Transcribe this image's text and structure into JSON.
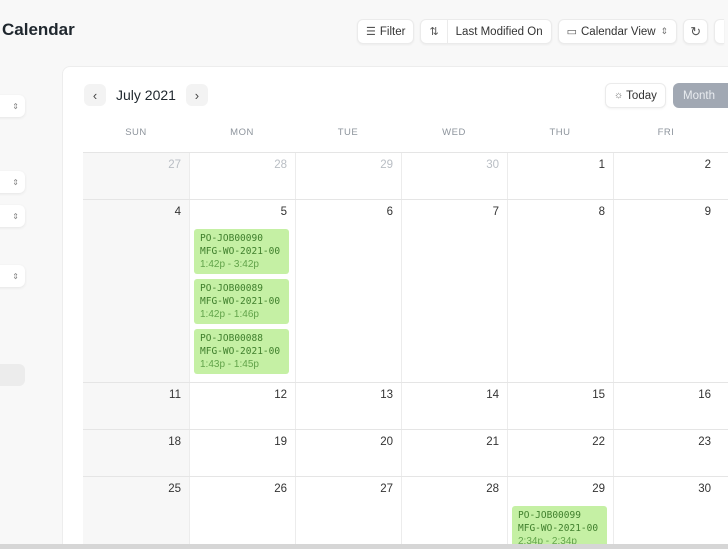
{
  "page": {
    "title": "Calendar"
  },
  "toolbar": {
    "filter_label": "Filter",
    "sort_label": "Last Modified On",
    "view_label": "Calendar View",
    "icons": {
      "filter": "filter-icon",
      "sort": "sort-icon",
      "calendar": "calendar-icon",
      "refresh": "refresh-icon"
    }
  },
  "sidebar": {
    "selects": [
      {
        "glyph": "⌃⌄"
      },
      {
        "glyph": "⌃⌄"
      },
      {
        "glyph": "⌃⌄"
      },
      {
        "glyph": "⌃⌄"
      }
    ]
  },
  "calendar": {
    "month_label": "July 2021",
    "prev_glyph": "‹",
    "next_glyph": "›",
    "today_label": "Today",
    "view_mode": "Month",
    "weekdays": [
      "SUN",
      "MON",
      "TUE",
      "WED",
      "THU",
      "FRI"
    ],
    "weeks": [
      {
        "days": [
          {
            "num": "27",
            "other": true
          },
          {
            "num": "28",
            "other": true
          },
          {
            "num": "29",
            "other": true
          },
          {
            "num": "30",
            "other": true
          },
          {
            "num": "1"
          },
          {
            "num": "2"
          }
        ]
      },
      {
        "days": [
          {
            "num": "4"
          },
          {
            "num": "5",
            "events": [
              {
                "title": "PO-JOB00090",
                "subtitle": "MFG-WO-2021-00",
                "time": "1:42p - 3:42p"
              },
              {
                "title": "PO-JOB00089",
                "subtitle": "MFG-WO-2021-00",
                "time": "1:42p - 1:46p"
              },
              {
                "title": "PO-JOB00088",
                "subtitle": "MFG-WO-2021-00",
                "time": "1:43p - 1:45p"
              }
            ]
          },
          {
            "num": "6"
          },
          {
            "num": "7"
          },
          {
            "num": "8"
          },
          {
            "num": "9"
          }
        ]
      },
      {
        "days": [
          {
            "num": "11"
          },
          {
            "num": "12"
          },
          {
            "num": "13"
          },
          {
            "num": "14"
          },
          {
            "num": "15"
          },
          {
            "num": "16"
          }
        ]
      },
      {
        "days": [
          {
            "num": "18"
          },
          {
            "num": "19"
          },
          {
            "num": "20"
          },
          {
            "num": "21"
          },
          {
            "num": "22"
          },
          {
            "num": "23"
          }
        ]
      },
      {
        "days": [
          {
            "num": "25"
          },
          {
            "num": "26"
          },
          {
            "num": "27"
          },
          {
            "num": "28"
          },
          {
            "num": "29",
            "events": [
              {
                "title": "PO-JOB00099",
                "subtitle": "MFG-WO-2021-00",
                "time": "2:34p - 2:34p"
              }
            ]
          },
          {
            "num": "30"
          }
        ]
      }
    ]
  },
  "colors": {
    "event_bg": "#c5f0a4",
    "event_text": "#3d7a2a",
    "month_btn_bg": "#a1a8b3"
  }
}
